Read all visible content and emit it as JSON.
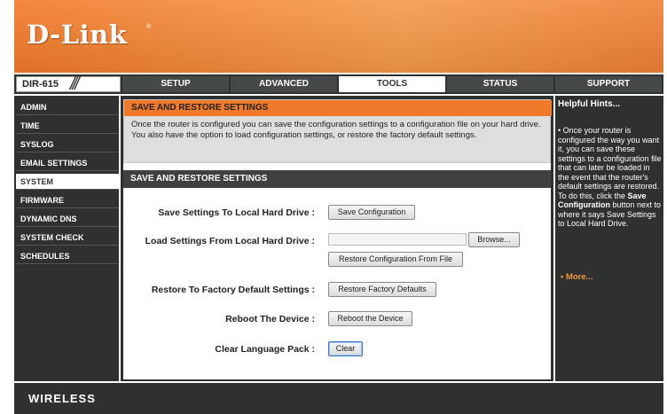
{
  "brand": {
    "logo": "D-Link",
    "reg": "®",
    "footer": "WIRELESS"
  },
  "model": {
    "name": "DIR-615",
    "slashes": "///"
  },
  "nav": {
    "tabs": [
      {
        "label": "SETUP"
      },
      {
        "label": "ADVANCED"
      },
      {
        "label": "TOOLS"
      },
      {
        "label": "STATUS"
      },
      {
        "label": "SUPPORT"
      }
    ],
    "active": "TOOLS"
  },
  "sidebar": {
    "items": [
      {
        "label": "ADMIN"
      },
      {
        "label": "TIME"
      },
      {
        "label": "SYSLOG"
      },
      {
        "label": "EMAIL SETTINGS"
      },
      {
        "label": "SYSTEM"
      },
      {
        "label": "FIRMWARE"
      },
      {
        "label": "DYNAMIC DNS"
      },
      {
        "label": "SYSTEM CHECK"
      },
      {
        "label": "SCHEDULES"
      }
    ],
    "active": "SYSTEM"
  },
  "intro": {
    "title": "SAVE AND RESTORE SETTINGS",
    "text": "Once the router is configured you can save the configuration settings to a configuration file on your hard drive. You also have the option to load configuration settings, or restore the factory default settings."
  },
  "section": {
    "title": "SAVE AND RESTORE SETTINGS",
    "save_label": "Save Settings To Local Hard Drive :",
    "save_button": "Save Configuration",
    "load_label": "Load Settings From Local Hard Drive :",
    "browse_button": "Browse...",
    "restore_file_button": "Restore Configuration From File",
    "factory_label": "Restore To Factory Default Settings :",
    "factory_button": "Restore Factory Defaults",
    "reboot_label": "Reboot The Device :",
    "reboot_button": "Reboot the Device",
    "clear_label": "Clear Language Pack :",
    "clear_button": "Clear"
  },
  "hints": {
    "title": "Helpful Hints...",
    "bullet": "•",
    "text_before": "Once your router is configured the way you want it, you can save these settings to a configuration file that can later be loaded in the event that the router's default settings are restored. To do this, click the ",
    "bold": "Save Configuration",
    "text_after": " button next to where it says Save Settings to Local Hard Drive.",
    "more": "More..."
  },
  "colors": {
    "orange": "#f07a2a",
    "dark": "#2f3130",
    "panel_gray": "#dedede",
    "more_link": "#f39a3c"
  }
}
